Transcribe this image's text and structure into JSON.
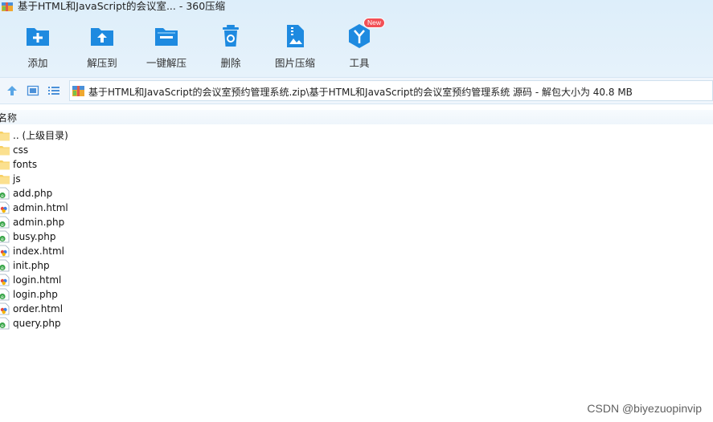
{
  "window": {
    "title": "基于HTML和JavaScript的会议室... - 360压缩"
  },
  "toolbar": {
    "add_label": "添加",
    "extract_to_label": "解压到",
    "one_click_extract_label": "一键解压",
    "delete_label": "删除",
    "image_compress_label": "图片压缩",
    "tools_label": "工具",
    "tools_badge": "New"
  },
  "navbar": {
    "path": "基于HTML和JavaScript的会议室预约管理系统.zip\\基于HTML和JavaScript的会议室预约管理系统 源码 - 解包大小为 40.8 MB"
  },
  "columns": {
    "name": "名称"
  },
  "files": [
    {
      "name": ".. (上级目录)",
      "type": "folder"
    },
    {
      "name": "css",
      "type": "folder"
    },
    {
      "name": "fonts",
      "type": "folder"
    },
    {
      "name": "js",
      "type": "folder"
    },
    {
      "name": "add.php",
      "type": "php"
    },
    {
      "name": "admin.html",
      "type": "html"
    },
    {
      "name": "admin.php",
      "type": "php"
    },
    {
      "name": "busy.php",
      "type": "php"
    },
    {
      "name": "index.html",
      "type": "html"
    },
    {
      "name": "init.php",
      "type": "php"
    },
    {
      "name": "login.html",
      "type": "html"
    },
    {
      "name": "login.php",
      "type": "php"
    },
    {
      "name": "order.html",
      "type": "html"
    },
    {
      "name": "query.php",
      "type": "php"
    }
  ],
  "watermark": "CSDN @biyezuopinvip",
  "colors": {
    "accent": "#1a8fe3",
    "toolbar_bg": "#e3f0fa",
    "folder": "#f7cf62",
    "badge": "#f25056"
  }
}
